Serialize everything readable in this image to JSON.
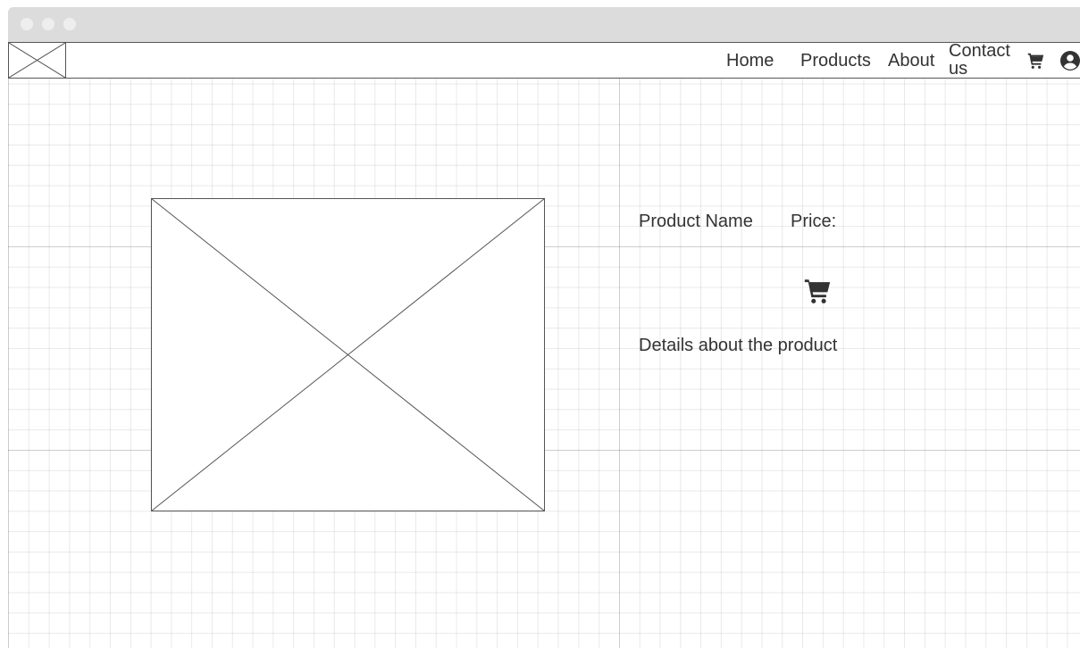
{
  "nav": {
    "links": [
      "Home",
      "Products",
      "About",
      "Contact us"
    ],
    "icons": [
      "cart-icon",
      "account-icon"
    ]
  },
  "product": {
    "name_label": "Product Name",
    "price_label": "Price:",
    "details": "Details about the product",
    "image_placeholder": "image-placeholder",
    "add_to_cart_icon": "cart-icon"
  },
  "colors": {
    "stroke": "#555555",
    "text": "#333333",
    "grid": "#e6e6e6",
    "chrome": "#dcdcdc"
  }
}
